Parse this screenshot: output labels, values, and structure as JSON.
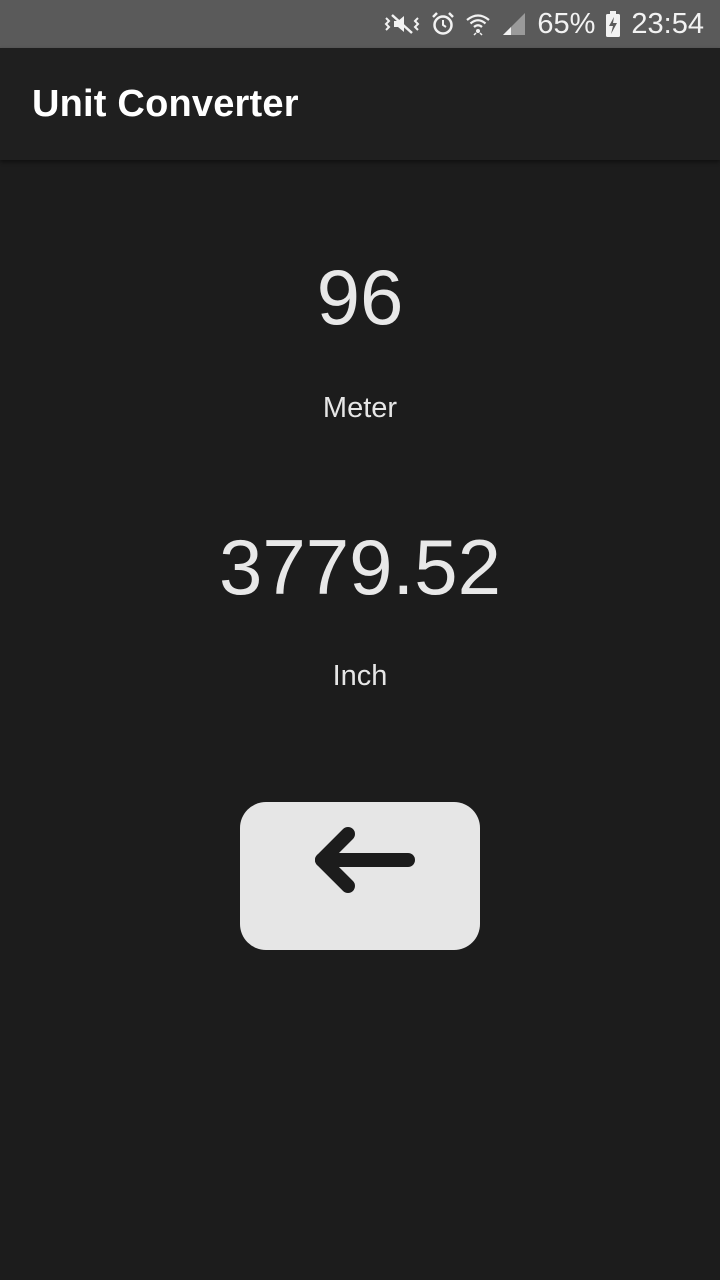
{
  "status_bar": {
    "battery_percent": "65%",
    "time": "23:54",
    "icons": [
      "mute-vibrate-icon",
      "alarm-icon",
      "wifi-icon",
      "signal-icon",
      "battery-charging-icon"
    ]
  },
  "app_bar": {
    "title": "Unit Converter"
  },
  "converter": {
    "from_value": "96",
    "from_unit": "Meter",
    "to_value": "3779.52",
    "to_unit": "Inch"
  },
  "back_button": {
    "icon": "arrow-left-icon"
  },
  "colors": {
    "background": "#1c1c1c",
    "status_bar": "#5a5a5a",
    "app_bar": "#1f1f1f",
    "text": "#e8e8e8",
    "button": "#e6e6e6",
    "icon_dark": "#1c1c1c"
  }
}
